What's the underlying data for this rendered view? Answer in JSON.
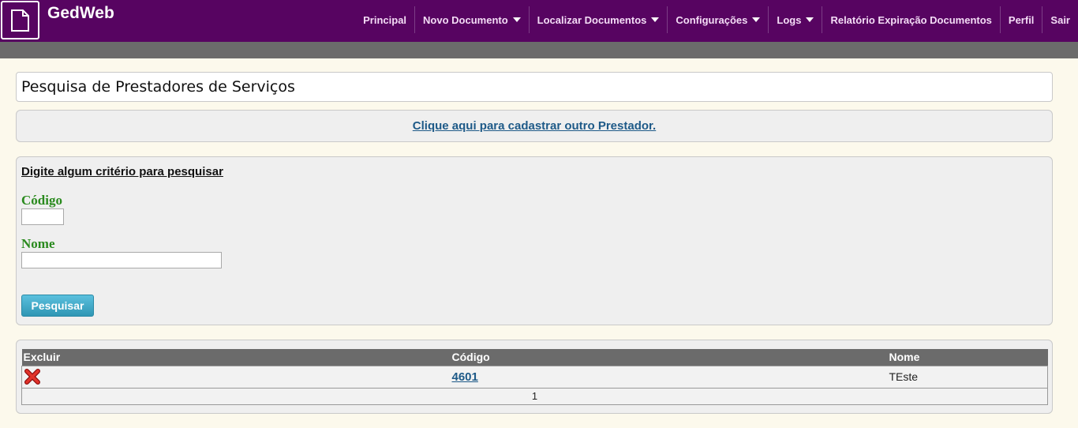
{
  "app": {
    "brand": "GedWeb",
    "logo_icon": "document-icon"
  },
  "nav": {
    "items": [
      {
        "label": "Principal",
        "has_dropdown": false
      },
      {
        "label": "Novo Documento",
        "has_dropdown": true
      },
      {
        "label": "Localizar Documentos",
        "has_dropdown": true
      },
      {
        "label": "Configurações",
        "has_dropdown": true
      },
      {
        "label": "Logs",
        "has_dropdown": true
      },
      {
        "label": "Relatório Expiração Documentos",
        "has_dropdown": false
      },
      {
        "label": "Perfil",
        "has_dropdown": false
      },
      {
        "label": "Sair",
        "has_dropdown": false
      }
    ]
  },
  "page": {
    "title": "Pesquisa de Prestadores de Serviços",
    "register_link": "Clique aqui para cadastrar outro Prestador."
  },
  "search": {
    "heading": "Digite algum critério para pesquisar",
    "codigo_label": "Código",
    "codigo_value": "",
    "nome_label": "Nome",
    "nome_value": "",
    "button_label": "Pesquisar"
  },
  "results": {
    "columns": [
      "Excluir",
      "Código",
      "Nome"
    ],
    "rows": [
      {
        "delete_icon": "delete-x-icon",
        "codigo": "4601",
        "nome": "TEste"
      }
    ],
    "pager": "1"
  },
  "colors": {
    "topbar": "#570461",
    "graybar": "#6b6b6b",
    "label_green": "#2a8a1e",
    "link_blue": "#1e5a88",
    "button_blue": "#2f96b4"
  }
}
